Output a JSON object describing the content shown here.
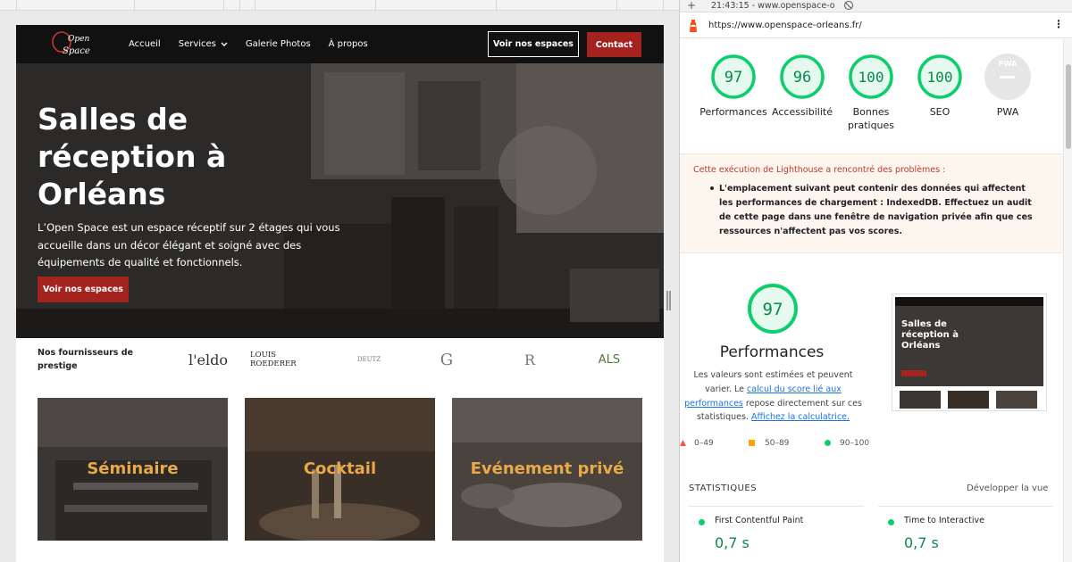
{
  "website": {
    "logo_text": [
      "Open",
      "Space"
    ],
    "nav": {
      "links": [
        "Accueil",
        "Services",
        "Galerie Photos",
        "À propos"
      ],
      "cta_outline": "Voir nos espaces",
      "cta_contact": "Contact"
    },
    "hero": {
      "title": "Salles de réception à Orléans",
      "text": "L’Open Space est un espace réceptif sur 2 étages qui vous accueille dans un décor élégant et soigné avec des équipements de qualité et fonctionnels.",
      "button": "Voir nos espaces"
    },
    "suppliers": {
      "label": "Nos fournisseurs de prestige",
      "logos": [
        "l'eldo",
        "LOUIS ROEDERER",
        "DEUTZ",
        "G",
        "R",
        "ALS"
      ]
    },
    "cards": [
      "Séminaire",
      "Cocktail",
      "Evénement privé"
    ],
    "colors": {
      "brand_red": "#a5231e",
      "card_title": "#e8a948"
    }
  },
  "devtools": {
    "time_url": "21:43:15 - www.openspace-o",
    "url": "https://www.openspace-orleans.fr/",
    "scores": [
      {
        "label": "Performances",
        "value": 97
      },
      {
        "label": "Accessibilité",
        "value": 96
      },
      {
        "label": "Bonnes pratiques",
        "value": 100
      },
      {
        "label": "SEO",
        "value": 100
      }
    ],
    "pwa": {
      "label": "PWA",
      "badge": "PWA"
    },
    "warning": {
      "heading": "Cette exécution de Lighthouse a rencontré des problèmes :",
      "item": "L'emplacement suivant peut contenir des données qui affectent les performances de chargement : IndexedDB. Effectuez un audit de cette page dans une fenêtre de navigation privée afin que ces ressources n'affectent pas vos scores."
    },
    "performance": {
      "score": 97,
      "title": "Performances",
      "desc_prefix": "Les valeurs sont estimées et peuvent varier. Le",
      "link1": "calcul du score lié aux performances",
      "desc_mid": "repose directement sur ces statistiques.",
      "link2": "Affichez la calculatrice."
    },
    "legend": [
      "0–49",
      "50–89",
      "90–100"
    ],
    "stats": {
      "title": "STATISTIQUES",
      "expand": "Développer la vue",
      "metrics": [
        {
          "name": "First Contentful Paint",
          "value": "0,7 s"
        },
        {
          "name": "Time to Interactive",
          "value": "0,7 s"
        }
      ]
    },
    "colors": {
      "pass": "#0cce6b",
      "average": "#ffa400",
      "fail": "#ff4e42",
      "pass_text": "#0a8a48"
    }
  }
}
